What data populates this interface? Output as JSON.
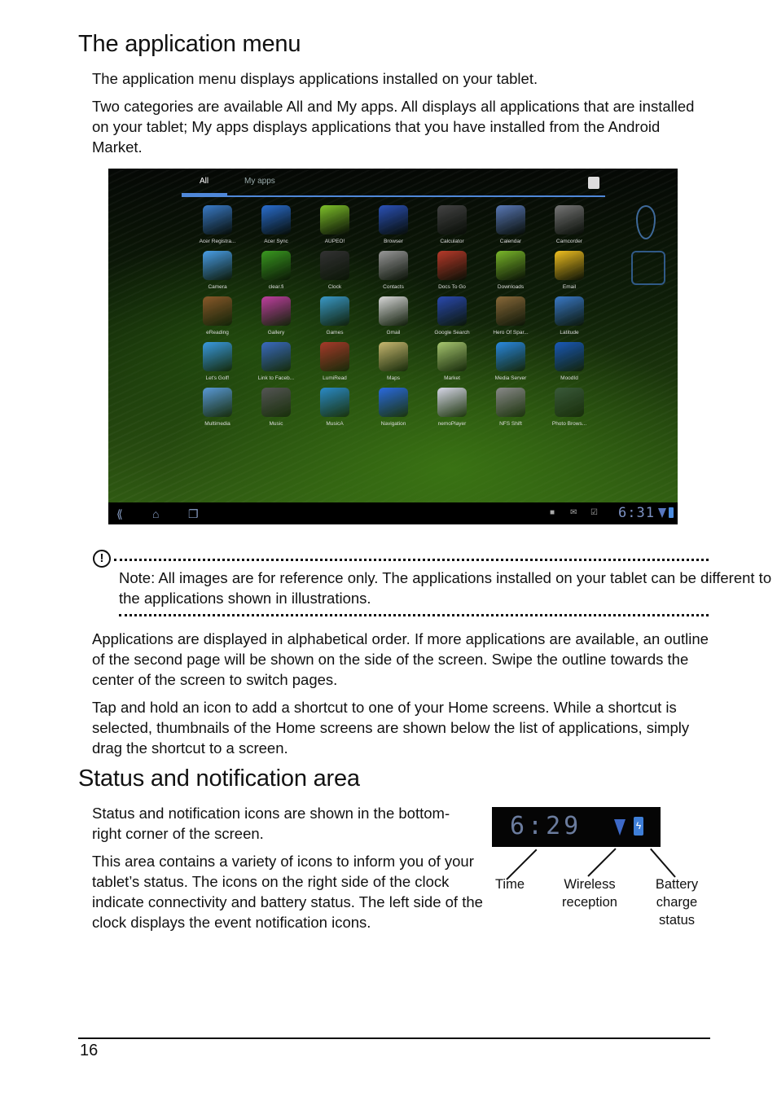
{
  "section1": {
    "heading": "The application menu",
    "para1": "The application menu displays applications installed on your tablet.",
    "para2_parts": [
      "Two categories are available ",
      "All",
      " and ",
      "My apps",
      ". ",
      "All",
      " displays all applications that are installed on your tablet; ",
      "My apps",
      " displays applications that you have installed from the Android Market."
    ]
  },
  "tablet": {
    "tabs": [
      "All",
      "My apps"
    ],
    "active_tab": "All",
    "apps": [
      {
        "label": "Acer Registra...",
        "color": "#3a7cc8"
      },
      {
        "label": "Acer Sync",
        "color": "#2a6fd0"
      },
      {
        "label": "AUPEO!",
        "color": "#7fc22a"
      },
      {
        "label": "Browser",
        "color": "#2b52b8"
      },
      {
        "label": "Calculator",
        "color": "#444444"
      },
      {
        "label": "Calendar",
        "color": "#5a7ab8"
      },
      {
        "label": "Camcorder",
        "color": "#777777"
      },
      {
        "label": "Camera",
        "color": "#4aa0e8"
      },
      {
        "label": "clear.fi",
        "color": "#3a9a20"
      },
      {
        "label": "Clock",
        "color": "#333333"
      },
      {
        "label": "Contacts",
        "color": "#999999"
      },
      {
        "label": "Docs To Go",
        "color": "#b83a2a"
      },
      {
        "label": "Downloads",
        "color": "#7ab82a"
      },
      {
        "label": "Email",
        "color": "#f0c020"
      },
      {
        "label": "eReading",
        "color": "#8a5a2a"
      },
      {
        "label": "Gallery",
        "color": "#c040a0"
      },
      {
        "label": "Games",
        "color": "#3a9ac8"
      },
      {
        "label": "Gmail",
        "color": "#d8d8d8"
      },
      {
        "label": "Google Search",
        "color": "#2a4ab0"
      },
      {
        "label": "Hero Of Spar...",
        "color": "#8a6a3a"
      },
      {
        "label": "Latitude",
        "color": "#3a7ac8"
      },
      {
        "label": "Let's Golf!",
        "color": "#3a9ae0"
      },
      {
        "label": "Link to Faceb...",
        "color": "#3a6ac0"
      },
      {
        "label": "LumiRead",
        "color": "#a83a2a"
      },
      {
        "label": "Maps",
        "color": "#c8b870"
      },
      {
        "label": "Market",
        "color": "#a8c870"
      },
      {
        "label": "Media Server",
        "color": "#2a8ae0"
      },
      {
        "label": "MoodId",
        "color": "#1a5ab8"
      },
      {
        "label": "Multimedia",
        "color": "#5a9ad8"
      },
      {
        "label": "Music",
        "color": "#555555"
      },
      {
        "label": "MusicA",
        "color": "#2a8ac8"
      },
      {
        "label": "Navigation",
        "color": "#2a6ae0"
      },
      {
        "label": "nemoPlayer",
        "color": "#d8d8e8"
      },
      {
        "label": "NFS Shift",
        "color": "#8a8a8a"
      },
      {
        "label": "Photo Brows...",
        "color": "#3a5a3a"
      }
    ],
    "nav_icons": [
      "back-icon",
      "home-icon",
      "recent-apps-icon"
    ],
    "status_icons": [
      "android-debug-icon",
      "gmail-notification-icon",
      "market-update-icon"
    ],
    "clock": "6:31"
  },
  "note": {
    "label": "Note:",
    "text": " All images are for reference only. The applications installed on your tablet can be different to the applications shown in illustrations."
  },
  "para3": "Applications are displayed in alphabetical order. If more applications are available, an outline of the second page will be shown on the side of the screen. Swipe the outline towards the center of the screen to switch pages.",
  "para4": "Tap and hold an icon to add a shortcut to one of your Home screens. While a shortcut is selected, thumbnails of the Home screens are shown below the list of applications, simply drag the shortcut to a screen.",
  "section2": {
    "heading": "Status and notification area",
    "para1": "Status and notification icons are shown in the bottom-right corner of the screen.",
    "para2": "This area contains a variety of icons to inform you of your tablet’s status. The icons on the right side of the clock indicate connectivity and battery status. The left side of the clock displays the event notification icons.",
    "status_clock": "6:29",
    "battery_glyph": "ϟ",
    "captions": {
      "time": "Time",
      "wireless": "Wireless reception",
      "battery": "Battery charge status"
    }
  },
  "footer": {
    "page_number": "16"
  }
}
